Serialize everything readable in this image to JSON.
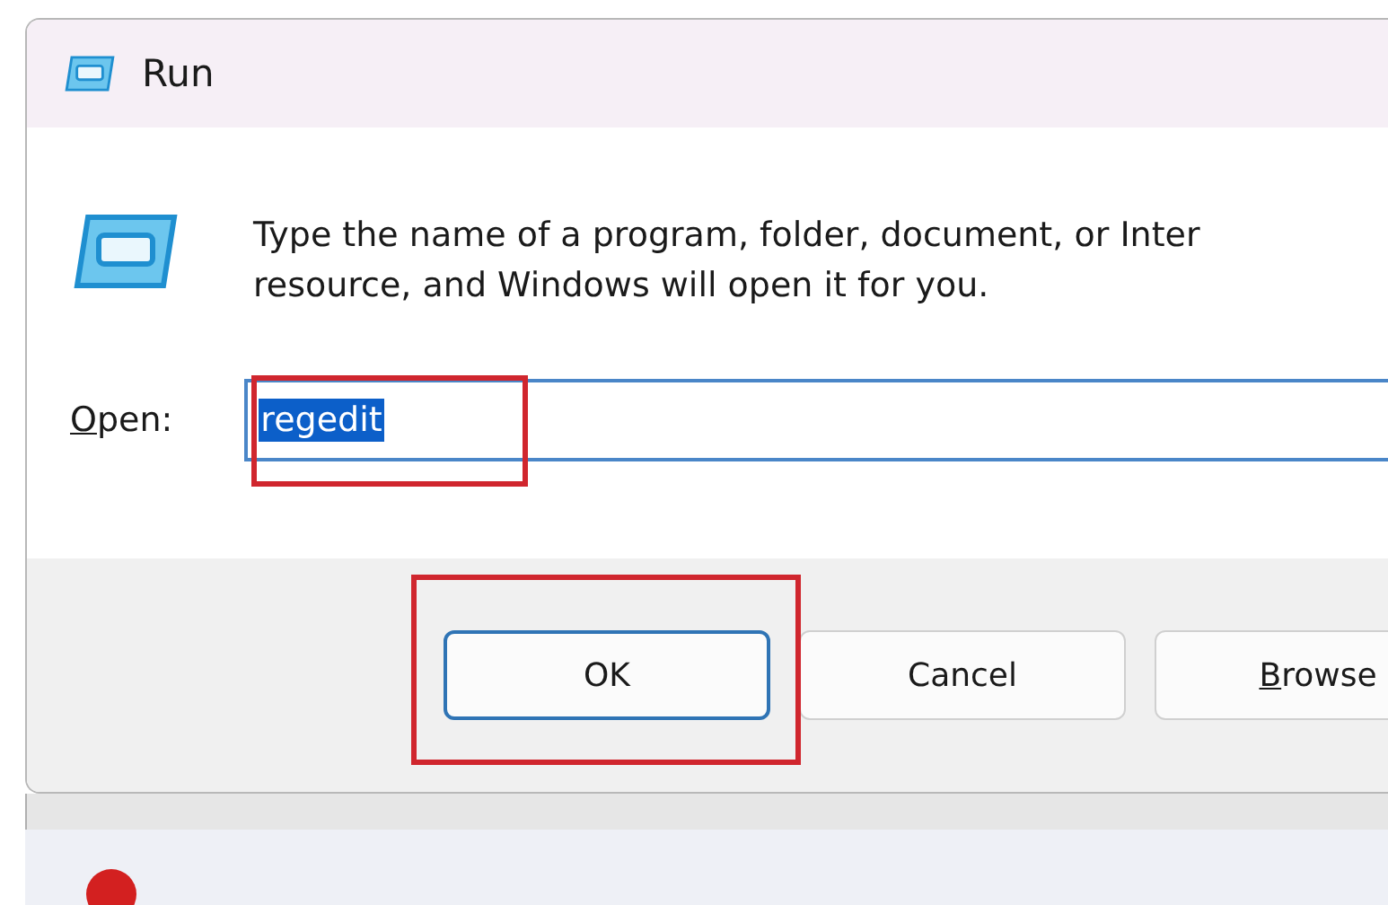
{
  "window": {
    "title": "Run"
  },
  "message": "Type the name of a program, folder, document, or Inter",
  "message_line_2": "resource, and Windows will open it for you.",
  "open_field": {
    "label": "Open:",
    "mnemonic": true,
    "value": "regedit",
    "selected": true,
    "highlighted": true
  },
  "buttons": [
    {
      "label": "OK",
      "default": true,
      "mnemonic": false,
      "highlighted": true
    },
    {
      "label": "Cancel",
      "default": false,
      "mnemonic": false,
      "highlighted": false
    },
    {
      "label": "Browse",
      "default": false,
      "mnemonic": true,
      "highlighted": false
    }
  ]
}
